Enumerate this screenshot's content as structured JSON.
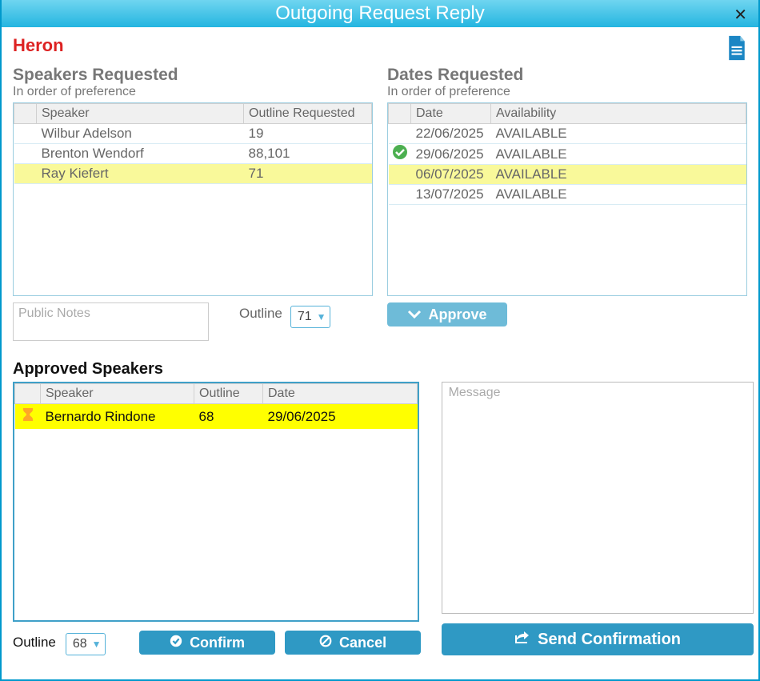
{
  "title": "Outgoing Request Reply",
  "congregation": "Heron",
  "speakers_section": {
    "title": "Speakers Requested",
    "sub": "In order of preference"
  },
  "dates_section": {
    "title": "Dates Requested",
    "sub": "In order of preference"
  },
  "speakers_headers": {
    "speaker": "Speaker",
    "outline": "Outline Requested"
  },
  "speakers": [
    {
      "name": "Wilbur Adelson",
      "outline": "19",
      "hl": false
    },
    {
      "name": "Brenton Wendorf",
      "outline": "88,101",
      "hl": false
    },
    {
      "name": "Ray Kiefert",
      "outline": "71",
      "hl": true
    }
  ],
  "dates_headers": {
    "date": "Date",
    "avail": "Availability"
  },
  "dates": [
    {
      "date": "22/06/2025",
      "avail": "AVAILABLE",
      "check": false,
      "hl": false
    },
    {
      "date": "29/06/2025",
      "avail": "AVAILABLE",
      "check": true,
      "hl": false
    },
    {
      "date": "06/07/2025",
      "avail": "AVAILABLE",
      "check": false,
      "hl": true
    },
    {
      "date": "13/07/2025",
      "avail": "AVAILABLE",
      "check": false,
      "hl": false
    }
  ],
  "public_notes_placeholder": "Public Notes",
  "outline_label": "Outline",
  "outline_dropdown_top": "71",
  "approve_label": "Approve",
  "approved_title": "Approved Speakers",
  "approved_headers": {
    "speaker": "Speaker",
    "outline": "Outline",
    "date": "Date"
  },
  "approved": [
    {
      "name": "Bernardo Rindone",
      "outline": "68",
      "date": "29/06/2025"
    }
  ],
  "message_placeholder": "Message",
  "outline_dropdown_bottom": "68",
  "confirm_label": "Confirm",
  "cancel_label": "Cancel",
  "send_label": "Send Confirmation"
}
